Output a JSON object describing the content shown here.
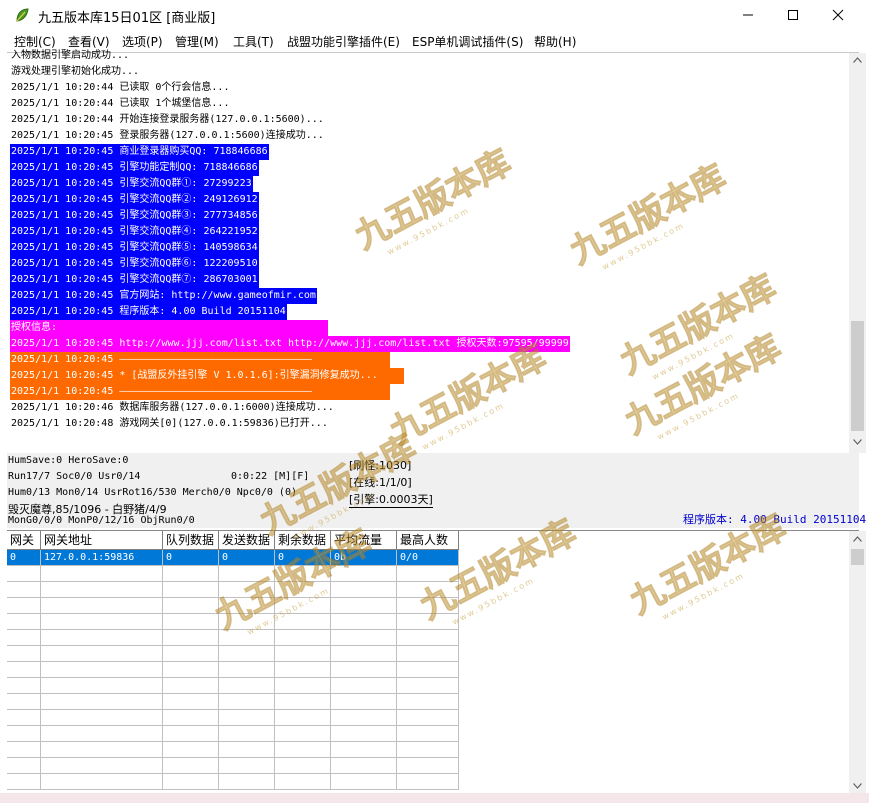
{
  "window": {
    "title": "九五版本库15日01区 [商业版]",
    "icon": "leaf-app-icon",
    "controls": [
      "minimize-icon",
      "maximize-icon",
      "close-icon"
    ]
  },
  "menu": [
    "控制(C)",
    "查看(V)",
    "选项(P)",
    "管理(M)",
    "工具(T)",
    "战盟功能引擎插件(E)",
    "ESP单机调试插件(S)",
    "帮助(H)"
  ],
  "log_lines": [
    {
      "text": "入物数据引擎启动成功...",
      "bg": "#ffffff",
      "fg": "#000000"
    },
    {
      "text": "游戏处理引擎初始化成功...",
      "bg": "#ffffff",
      "fg": "#000000"
    },
    {
      "text": "2025/1/1 10:20:44 已读取 0个行会信息...",
      "bg": "#ffffff",
      "fg": "#000000"
    },
    {
      "text": "2025/1/1 10:20:44 已读取 1个城堡信息...",
      "bg": "#ffffff",
      "fg": "#000000"
    },
    {
      "text": "2025/1/1 10:20:44 开始连接登录服务器(127.0.0.1:5600)...",
      "bg": "#ffffff",
      "fg": "#000000"
    },
    {
      "text": "2025/1/1 10:20:45 登录服务器(127.0.0.1:5600)连接成功...",
      "bg": "#ffffff",
      "fg": "#000000"
    },
    {
      "text": "2025/1/1 10:20:45 商业登录器购买QQ: 718846686",
      "bg": "#0000ff",
      "fg": "#ffffff"
    },
    {
      "text": "2025/1/1 10:20:45 引擎功能定制QQ: 718846686",
      "bg": "#0000ff",
      "fg": "#ffffff"
    },
    {
      "text": "2025/1/1 10:20:45 引擎交流QQ群①: 27299223",
      "bg": "#0000ff",
      "fg": "#ffffff"
    },
    {
      "text": "2025/1/1 10:20:45 引擎交流QQ群②: 249126912",
      "bg": "#0000ff",
      "fg": "#ffffff"
    },
    {
      "text": "2025/1/1 10:20:45 引擎交流QQ群③: 277734856",
      "bg": "#0000ff",
      "fg": "#ffffff"
    },
    {
      "text": "2025/1/1 10:20:45 引擎交流QQ群④: 264221952",
      "bg": "#0000ff",
      "fg": "#ffffff"
    },
    {
      "text": "2025/1/1 10:20:45 引擎交流QQ群⑤: 140598634",
      "bg": "#0000ff",
      "fg": "#ffffff"
    },
    {
      "text": "2025/1/1 10:20:45 引擎交流QQ群⑥: 122209510",
      "bg": "#0000ff",
      "fg": "#ffffff"
    },
    {
      "text": "2025/1/1 10:20:45 引擎交流QQ群⑦: 286703001",
      "bg": "#0000ff",
      "fg": "#ffffff"
    },
    {
      "text": "2025/1/1 10:20:45 官方网站: http://www.gameofmir.com",
      "bg": "#0000ff",
      "fg": "#ffffff"
    },
    {
      "text": "2025/1/1 10:20:45 程序版本: 4.00 Build 20151104",
      "bg": "#0000ff",
      "fg": "#ffffff"
    },
    {
      "text": "授权信息:",
      "bg": "#ff00ff",
      "fg": "#ffffff"
    },
    {
      "text": "2025/1/1 10:20:45 http://www.jjj.com/list.txt http://www.jjj.com/list.txt 授权天数:97595/99999",
      "bg": "#ff00ff",
      "fg": "#ffffff"
    },
    {
      "text": "2025/1/1 10:20:45 ————————————————————————————————",
      "bg": "#ff6a00",
      "fg": "#ffffff"
    },
    {
      "text": "2025/1/1 10:20:45 * [战盟反外挂引擎 V 1.0.1.6]:引擎漏洞修复成功...",
      "bg": "#ff6a00",
      "fg": "#ffffff"
    },
    {
      "text": "2025/1/1 10:20:45 ————————————————————————————————",
      "bg": "#ff6a00",
      "fg": "#ffffff"
    },
    {
      "text": "2025/1/1 10:20:46 数据库服务器(127.0.0.1:6000)连接成功...",
      "bg": "#ffffff",
      "fg": "#000000"
    },
    {
      "text": "2025/1/1 10:20:48 游戏网关[0](127.0.0.1:59836)已打开...",
      "bg": "#ffffff",
      "fg": "#000000"
    }
  ],
  "status": {
    "line1": "HumSave:0 HeroSave:0",
    "line2": "Run17/7 Soc0/0 Usr0/14",
    "timer": "0:0:22 [M][F]",
    "line3": "Hum0/13 Mon0/14 UsrRot16/530 Merch0/0 Npc0/0 (0)",
    "line4": "毁灭魔尊,85/1096 - 白野猪/4/9",
    "line5": "MonG0/0/0 MonP0/12/16 ObjRun0/0",
    "monster_refresh": "[刷怪:1030]",
    "online": "[在线:1/1/0]",
    "engine": "[引擎:0.0003天]",
    "version": "程序版本: 4.00 Build 20151104"
  },
  "grid": {
    "columns": [
      "网关",
      "网关地址",
      "队列数据",
      "发送数据",
      "剩余数据",
      "平均流量",
      "最高人数"
    ],
    "rows": [
      [
        "0",
        "127.0.0.1:59836",
        "0",
        "0",
        "0",
        "0b",
        "0/0"
      ]
    ]
  },
  "watermark": {
    "text": "九五版本库",
    "sub": "www.95bbk.com"
  },
  "colors": {
    "selection": "#0078d7",
    "blue_line": "#0000ff",
    "magenta_line": "#ff00ff",
    "orange_line": "#ff6a00",
    "version_text": "#0000cc"
  }
}
